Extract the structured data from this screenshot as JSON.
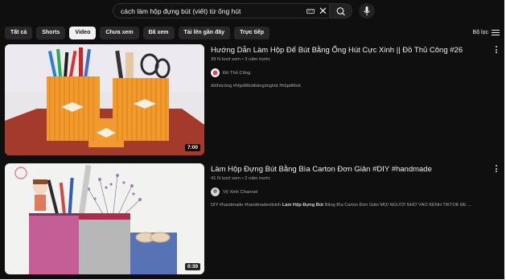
{
  "search": {
    "query": "cách làm hộp đựng bút (viết) từ ống hút"
  },
  "chips": [
    "Tất cả",
    "Shorts",
    "Video",
    "Chưa xem",
    "Đã xem",
    "Tải lên gần đây",
    "Trực tiếp"
  ],
  "active_chip": "Video",
  "filter_label": "Bộ lọc",
  "results": [
    {
      "title": "Hướng Dẫn Làm Hộp Để Bút Bằng Ống Hút Cực Xinh || Đồ Thủ Công #26",
      "views": "39 N lượt xem",
      "age": "3 năm trước",
      "channel": "Đồ Thủ Công",
      "description": "đồthủcông #hộpđểbútbằngốnghút #hộpđểbút.",
      "duration": "7:00"
    },
    {
      "title": "Làm Hộp Đựng Bút Bằng Bìa Carton Đơn Giản #DIY #handmade",
      "views": "41 N lượt xem",
      "age": "2 năm trước",
      "channel": "Vỹ Xinh Channel",
      "description_pre": "DIY #handmade #handmadevitxinh ",
      "description_bold": "Làm Hộp Đựng Bút",
      "description_post": " Bằng Bìa Carton Đơn Giản MỌI NGƯỜI NHỚ VÀO KÊNH TIKTOK ĐỂ ...",
      "duration": "0:39"
    }
  ],
  "colors": {
    "background": "#0f0f0f",
    "chip": "#272727",
    "chip_active": "#f1f1f1",
    "text": "#f1f1f1",
    "secondary_text": "#aaaaaa"
  }
}
